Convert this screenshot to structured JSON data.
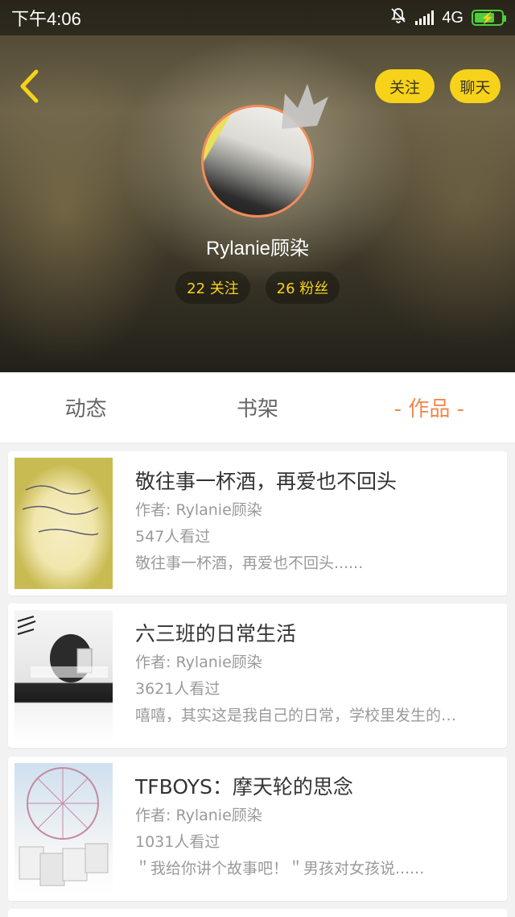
{
  "status_bar": {
    "time": "下午4:06",
    "network": "4G",
    "icons": [
      "bell-muted-icon",
      "hd-signal-icon",
      "battery-charging-icon"
    ]
  },
  "header": {
    "back_icon": "chevron-left-icon",
    "follow_label": "关注",
    "chat_label": "聊天",
    "nickname": "Rylanie顾染",
    "following_text": "22 关注",
    "followers_text": "26 粉丝",
    "accent_color": "#f6d21a",
    "avatar_border_color": "#f28c5a"
  },
  "tabs": [
    {
      "label": "动态",
      "active": false
    },
    {
      "label": "书架",
      "active": false
    },
    {
      "label": "- 作品 -",
      "active": true
    }
  ],
  "works": [
    {
      "title": "敬往事一杯酒，再爱也不回头",
      "author": "作者: Rylanie顾染",
      "views": "547人看过",
      "description": "敬往事一杯酒，再爱也不回头......"
    },
    {
      "title": "六三班的日常生活",
      "author": "作者: Rylanie顾染",
      "views": "3621人看过",
      "description": "嘻嘻，其实这是我自己的日常，学校里发生的…"
    },
    {
      "title": "TFBOYS：摩天轮的思念",
      "author": "作者: Rylanie顾染",
      "views": "1031人看过",
      "description": "＂我给你讲个故事吧！＂男孩对女孩说......"
    }
  ],
  "colors": {
    "active_tab": "#f0894a",
    "pill_bg": "#f6d21a",
    "muted_text": "#9a9a9a"
  }
}
